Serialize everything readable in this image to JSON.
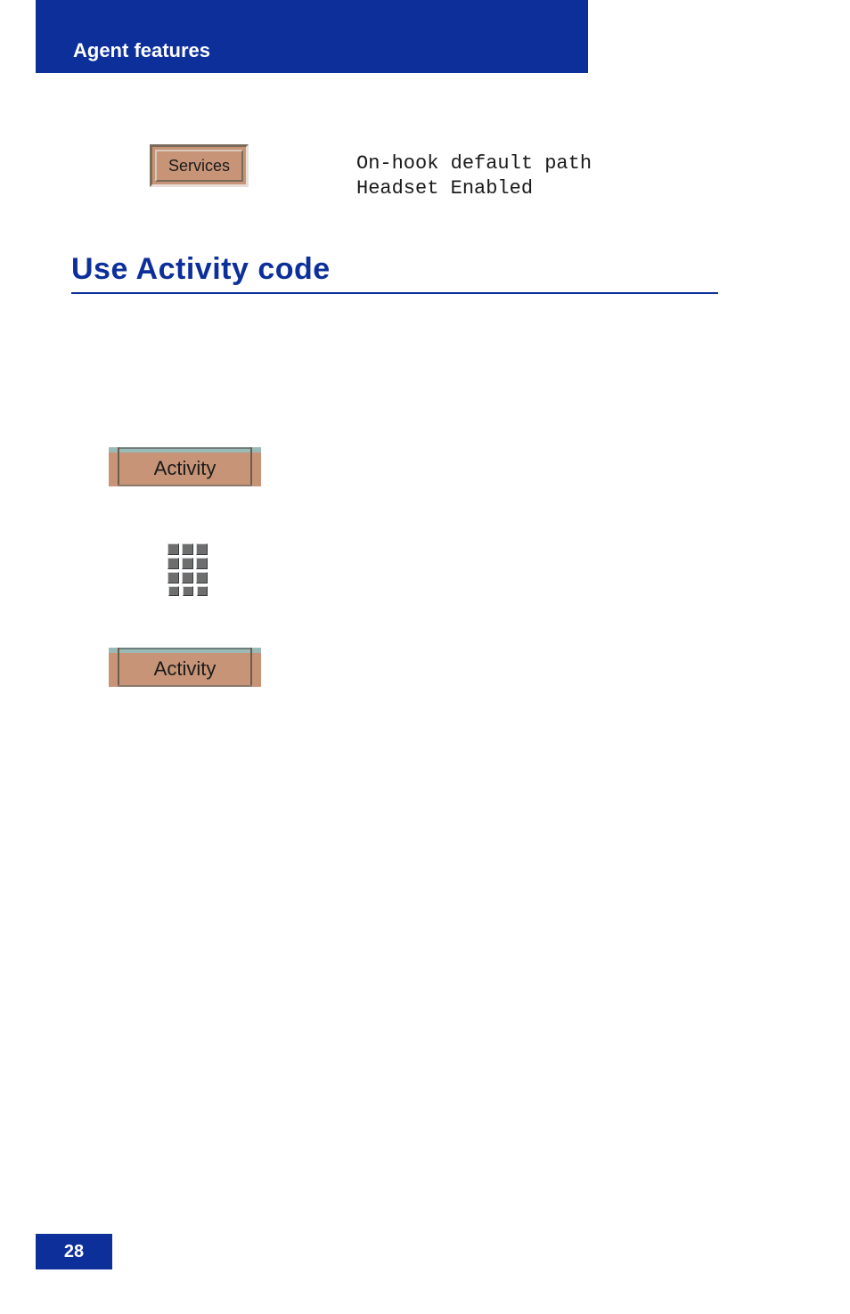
{
  "header": {
    "title": "Agent features"
  },
  "services_button": {
    "label": "Services"
  },
  "display": {
    "line1": "On-hook default path",
    "line2": "Headset Enabled"
  },
  "section": {
    "heading": "Use Activity code"
  },
  "activity_button_1": {
    "label": "Activity"
  },
  "activity_button_2": {
    "label": "Activity"
  },
  "footer": {
    "page_number": "28"
  }
}
